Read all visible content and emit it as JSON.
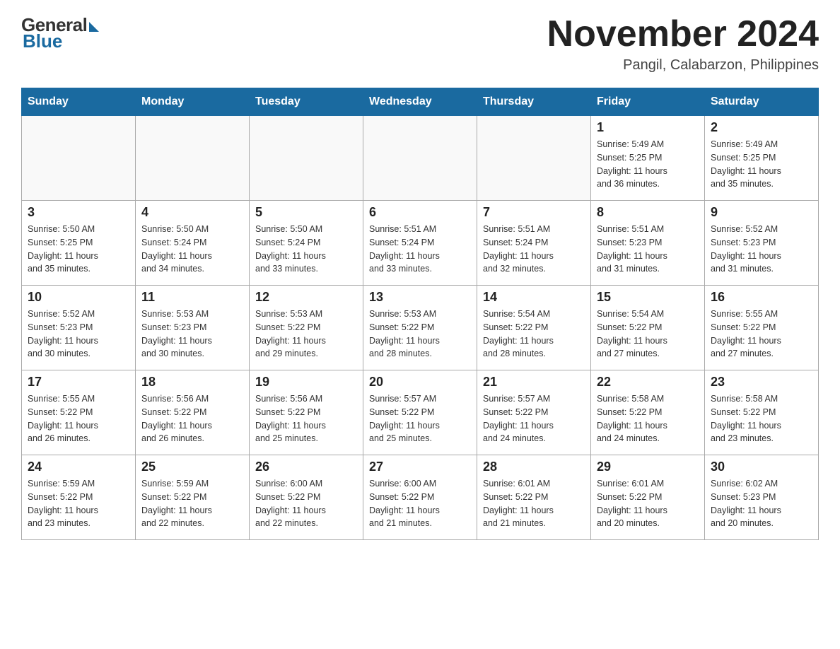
{
  "logo": {
    "general": "General",
    "blue": "Blue"
  },
  "title": "November 2024",
  "location": "Pangil, Calabarzon, Philippines",
  "weekdays": [
    "Sunday",
    "Monday",
    "Tuesday",
    "Wednesday",
    "Thursday",
    "Friday",
    "Saturday"
  ],
  "weeks": [
    [
      {
        "day": "",
        "info": ""
      },
      {
        "day": "",
        "info": ""
      },
      {
        "day": "",
        "info": ""
      },
      {
        "day": "",
        "info": ""
      },
      {
        "day": "",
        "info": ""
      },
      {
        "day": "1",
        "info": "Sunrise: 5:49 AM\nSunset: 5:25 PM\nDaylight: 11 hours\nand 36 minutes."
      },
      {
        "day": "2",
        "info": "Sunrise: 5:49 AM\nSunset: 5:25 PM\nDaylight: 11 hours\nand 35 minutes."
      }
    ],
    [
      {
        "day": "3",
        "info": "Sunrise: 5:50 AM\nSunset: 5:25 PM\nDaylight: 11 hours\nand 35 minutes."
      },
      {
        "day": "4",
        "info": "Sunrise: 5:50 AM\nSunset: 5:24 PM\nDaylight: 11 hours\nand 34 minutes."
      },
      {
        "day": "5",
        "info": "Sunrise: 5:50 AM\nSunset: 5:24 PM\nDaylight: 11 hours\nand 33 minutes."
      },
      {
        "day": "6",
        "info": "Sunrise: 5:51 AM\nSunset: 5:24 PM\nDaylight: 11 hours\nand 33 minutes."
      },
      {
        "day": "7",
        "info": "Sunrise: 5:51 AM\nSunset: 5:24 PM\nDaylight: 11 hours\nand 32 minutes."
      },
      {
        "day": "8",
        "info": "Sunrise: 5:51 AM\nSunset: 5:23 PM\nDaylight: 11 hours\nand 31 minutes."
      },
      {
        "day": "9",
        "info": "Sunrise: 5:52 AM\nSunset: 5:23 PM\nDaylight: 11 hours\nand 31 minutes."
      }
    ],
    [
      {
        "day": "10",
        "info": "Sunrise: 5:52 AM\nSunset: 5:23 PM\nDaylight: 11 hours\nand 30 minutes."
      },
      {
        "day": "11",
        "info": "Sunrise: 5:53 AM\nSunset: 5:23 PM\nDaylight: 11 hours\nand 30 minutes."
      },
      {
        "day": "12",
        "info": "Sunrise: 5:53 AM\nSunset: 5:22 PM\nDaylight: 11 hours\nand 29 minutes."
      },
      {
        "day": "13",
        "info": "Sunrise: 5:53 AM\nSunset: 5:22 PM\nDaylight: 11 hours\nand 28 minutes."
      },
      {
        "day": "14",
        "info": "Sunrise: 5:54 AM\nSunset: 5:22 PM\nDaylight: 11 hours\nand 28 minutes."
      },
      {
        "day": "15",
        "info": "Sunrise: 5:54 AM\nSunset: 5:22 PM\nDaylight: 11 hours\nand 27 minutes."
      },
      {
        "day": "16",
        "info": "Sunrise: 5:55 AM\nSunset: 5:22 PM\nDaylight: 11 hours\nand 27 minutes."
      }
    ],
    [
      {
        "day": "17",
        "info": "Sunrise: 5:55 AM\nSunset: 5:22 PM\nDaylight: 11 hours\nand 26 minutes."
      },
      {
        "day": "18",
        "info": "Sunrise: 5:56 AM\nSunset: 5:22 PM\nDaylight: 11 hours\nand 26 minutes."
      },
      {
        "day": "19",
        "info": "Sunrise: 5:56 AM\nSunset: 5:22 PM\nDaylight: 11 hours\nand 25 minutes."
      },
      {
        "day": "20",
        "info": "Sunrise: 5:57 AM\nSunset: 5:22 PM\nDaylight: 11 hours\nand 25 minutes."
      },
      {
        "day": "21",
        "info": "Sunrise: 5:57 AM\nSunset: 5:22 PM\nDaylight: 11 hours\nand 24 minutes."
      },
      {
        "day": "22",
        "info": "Sunrise: 5:58 AM\nSunset: 5:22 PM\nDaylight: 11 hours\nand 24 minutes."
      },
      {
        "day": "23",
        "info": "Sunrise: 5:58 AM\nSunset: 5:22 PM\nDaylight: 11 hours\nand 23 minutes."
      }
    ],
    [
      {
        "day": "24",
        "info": "Sunrise: 5:59 AM\nSunset: 5:22 PM\nDaylight: 11 hours\nand 23 minutes."
      },
      {
        "day": "25",
        "info": "Sunrise: 5:59 AM\nSunset: 5:22 PM\nDaylight: 11 hours\nand 22 minutes."
      },
      {
        "day": "26",
        "info": "Sunrise: 6:00 AM\nSunset: 5:22 PM\nDaylight: 11 hours\nand 22 minutes."
      },
      {
        "day": "27",
        "info": "Sunrise: 6:00 AM\nSunset: 5:22 PM\nDaylight: 11 hours\nand 21 minutes."
      },
      {
        "day": "28",
        "info": "Sunrise: 6:01 AM\nSunset: 5:22 PM\nDaylight: 11 hours\nand 21 minutes."
      },
      {
        "day": "29",
        "info": "Sunrise: 6:01 AM\nSunset: 5:22 PM\nDaylight: 11 hours\nand 20 minutes."
      },
      {
        "day": "30",
        "info": "Sunrise: 6:02 AM\nSunset: 5:23 PM\nDaylight: 11 hours\nand 20 minutes."
      }
    ]
  ]
}
